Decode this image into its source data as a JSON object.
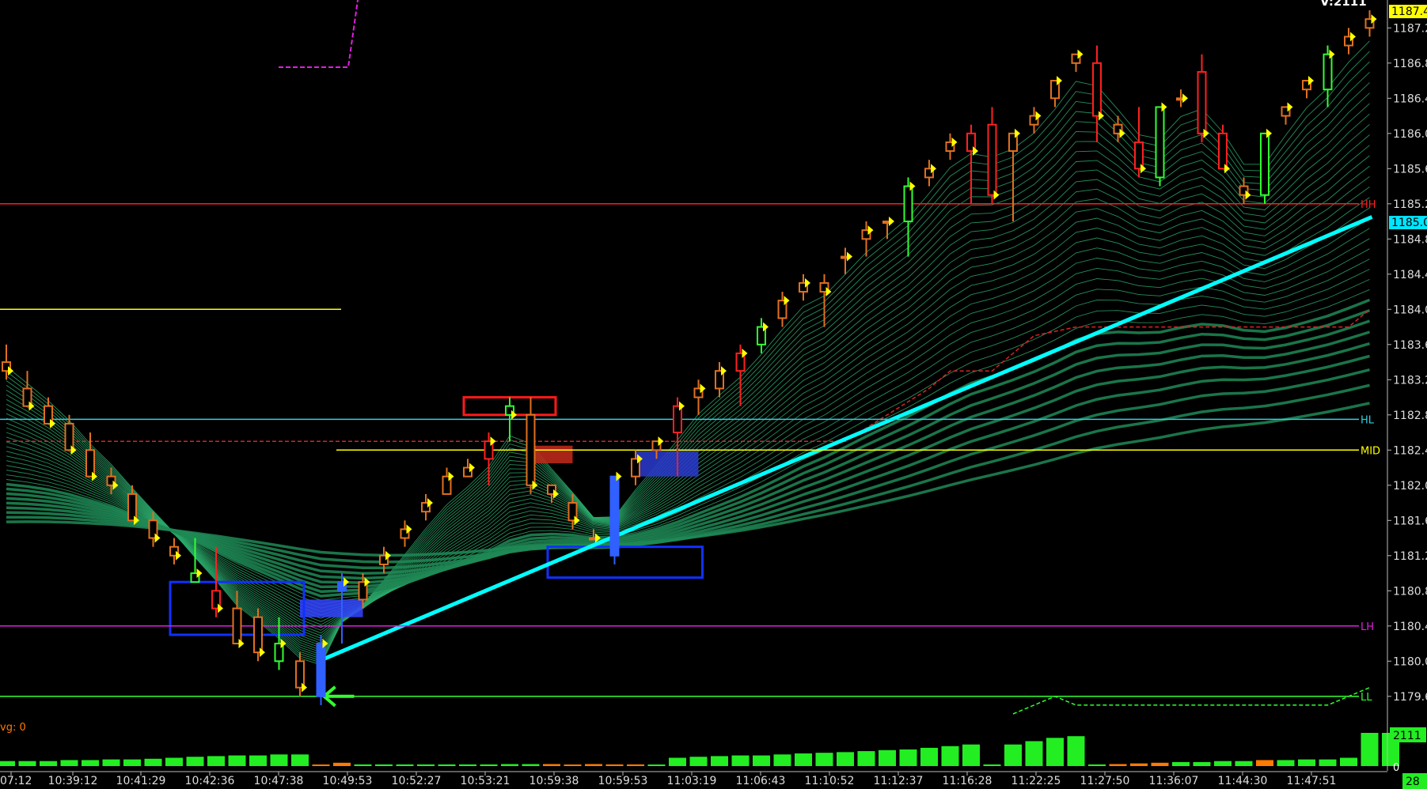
{
  "chart_data": {
    "type": "candlestick",
    "title": "",
    "corner_label": "V:2111",
    "avg_label": "vg: 0",
    "ylim": [
      1179.2,
      1187.6
    ],
    "y_ticks": [
      "1187.2",
      "1186.8",
      "1186.4",
      "1186.0",
      "1185.6",
      "1185.2",
      "1184.8",
      "1184.4",
      "1184.0",
      "1183.6",
      "1183.2",
      "1182.8",
      "1182.4",
      "1182.0",
      "1181.6",
      "1181.2",
      "1180.8",
      "1180.4",
      "1180.0",
      "1179.6"
    ],
    "x_ticks": [
      "07:12",
      "10:39:12",
      "10:41:29",
      "10:42:36",
      "10:47:38",
      "10:49:53",
      "10:52:27",
      "10:53:21",
      "10:59:38",
      "10:59:53",
      "11:03:19",
      "11:06:43",
      "11:10:52",
      "11:12:37",
      "11:16:28",
      "11:22:25",
      "11:27:50",
      "11:36:07",
      "11:44:30",
      "11:47:51"
    ],
    "current_price_label": "1187.4",
    "trendline_price_label": "1185.0",
    "volume_label": "2111",
    "volume_zero_label": "0",
    "volume_right_label": "28",
    "levels": [
      {
        "name": "HH",
        "price": 1185.2,
        "color": "#ff2020"
      },
      {
        "name": "HL",
        "price": 1182.75,
        "color": "#30d0e0"
      },
      {
        "name": "MID",
        "price": 1182.4,
        "color": "#ffff00"
      },
      {
        "name": "LH",
        "price": 1180.4,
        "color": "#e020e0"
      },
      {
        "name": "LL",
        "price": 1179.6,
        "color": "#30ff30"
      }
    ],
    "candles": [
      {
        "o": 1183.4,
        "h": 1183.6,
        "l": 1183.2,
        "c": 1183.3,
        "color": "#e07020"
      },
      {
        "o": 1183.1,
        "h": 1183.3,
        "l": 1182.9,
        "c": 1182.9,
        "color": "#e07020"
      },
      {
        "o": 1182.9,
        "h": 1183.0,
        "l": 1182.7,
        "c": 1182.7,
        "color": "#e07020"
      },
      {
        "o": 1182.7,
        "h": 1182.8,
        "l": 1182.4,
        "c": 1182.4,
        "color": "#e07020"
      },
      {
        "o": 1182.4,
        "h": 1182.6,
        "l": 1182.1,
        "c": 1182.1,
        "color": "#e07020"
      },
      {
        "o": 1182.1,
        "h": 1182.2,
        "l": 1181.9,
        "c": 1182.0,
        "color": "#e07020"
      },
      {
        "o": 1181.9,
        "h": 1182.0,
        "l": 1181.6,
        "c": 1181.6,
        "color": "#e07020"
      },
      {
        "o": 1181.6,
        "h": 1181.7,
        "l": 1181.3,
        "c": 1181.4,
        "color": "#e07020"
      },
      {
        "o": 1181.3,
        "h": 1181.4,
        "l": 1181.1,
        "c": 1181.2,
        "color": "#e07020"
      },
      {
        "o": 1180.9,
        "h": 1181.4,
        "l": 1180.9,
        "c": 1181.0,
        "color": "#30ff30"
      },
      {
        "o": 1180.8,
        "h": 1181.3,
        "l": 1180.5,
        "c": 1180.6,
        "color": "#ff2020"
      },
      {
        "o": 1180.6,
        "h": 1180.8,
        "l": 1180.2,
        "c": 1180.2,
        "color": "#e07020"
      },
      {
        "o": 1180.5,
        "h": 1180.6,
        "l": 1180.0,
        "c": 1180.1,
        "color": "#e07020"
      },
      {
        "o": 1180.0,
        "h": 1180.5,
        "l": 1179.9,
        "c": 1180.2,
        "color": "#30ff30"
      },
      {
        "o": 1180.0,
        "h": 1180.1,
        "l": 1179.6,
        "c": 1179.7,
        "color": "#e07020"
      },
      {
        "o": 1179.6,
        "h": 1180.3,
        "l": 1179.5,
        "c": 1180.2,
        "color": "#3060ff"
      },
      {
        "o": 1180.8,
        "h": 1181.0,
        "l": 1180.2,
        "c": 1180.9,
        "color": "#3060ff"
      },
      {
        "o": 1180.7,
        "h": 1181.0,
        "l": 1180.6,
        "c": 1180.9,
        "color": "#e07020"
      },
      {
        "o": 1181.1,
        "h": 1181.3,
        "l": 1181.0,
        "c": 1181.2,
        "color": "#e07020"
      },
      {
        "o": 1181.4,
        "h": 1181.6,
        "l": 1181.3,
        "c": 1181.5,
        "color": "#e07020"
      },
      {
        "o": 1181.7,
        "h": 1181.9,
        "l": 1181.6,
        "c": 1181.8,
        "color": "#e07020"
      },
      {
        "o": 1181.9,
        "h": 1182.2,
        "l": 1181.9,
        "c": 1182.1,
        "color": "#e07020"
      },
      {
        "o": 1182.1,
        "h": 1182.3,
        "l": 1182.1,
        "c": 1182.2,
        "color": "#e07020"
      },
      {
        "o": 1182.3,
        "h": 1182.6,
        "l": 1182.0,
        "c": 1182.5,
        "color": "#ff2020"
      },
      {
        "o": 1182.9,
        "h": 1183.0,
        "l": 1182.5,
        "c": 1182.8,
        "color": "#30ff30"
      },
      {
        "o": 1182.8,
        "h": 1183.0,
        "l": 1181.9,
        "c": 1182.0,
        "color": "#e07020"
      },
      {
        "o": 1182.0,
        "h": 1182.0,
        "l": 1181.8,
        "c": 1181.9,
        "color": "#e07020"
      },
      {
        "o": 1181.8,
        "h": 1181.9,
        "l": 1181.5,
        "c": 1181.6,
        "color": "#e07020"
      },
      {
        "o": 1181.4,
        "h": 1181.5,
        "l": 1181.4,
        "c": 1181.4,
        "color": "#e07020"
      },
      {
        "o": 1181.2,
        "h": 1182.1,
        "l": 1181.1,
        "c": 1182.1,
        "color": "#3060ff"
      },
      {
        "o": 1182.1,
        "h": 1182.4,
        "l": 1182.0,
        "c": 1182.3,
        "color": "#e07020"
      },
      {
        "o": 1182.4,
        "h": 1182.5,
        "l": 1182.3,
        "c": 1182.5,
        "color": "#e07020"
      },
      {
        "o": 1182.6,
        "h": 1183.0,
        "l": 1182.1,
        "c": 1182.9,
        "color": "#ff2020"
      },
      {
        "o": 1183.0,
        "h": 1183.2,
        "l": 1182.8,
        "c": 1183.1,
        "color": "#e07020"
      },
      {
        "o": 1183.1,
        "h": 1183.4,
        "l": 1183.0,
        "c": 1183.3,
        "color": "#e07020"
      },
      {
        "o": 1183.3,
        "h": 1183.6,
        "l": 1182.9,
        "c": 1183.5,
        "color": "#ff2020"
      },
      {
        "o": 1183.6,
        "h": 1183.9,
        "l": 1183.5,
        "c": 1183.8,
        "color": "#30ff30"
      },
      {
        "o": 1183.9,
        "h": 1184.2,
        "l": 1183.8,
        "c": 1184.1,
        "color": "#e07020"
      },
      {
        "o": 1184.2,
        "h": 1184.4,
        "l": 1184.1,
        "c": 1184.3,
        "color": "#e07020"
      },
      {
        "o": 1184.3,
        "h": 1184.4,
        "l": 1183.8,
        "c": 1184.2,
        "color": "#e07020"
      },
      {
        "o": 1184.6,
        "h": 1184.7,
        "l": 1184.4,
        "c": 1184.6,
        "color": "#e07020"
      },
      {
        "o": 1184.8,
        "h": 1185.0,
        "l": 1184.6,
        "c": 1184.9,
        "color": "#e07020"
      },
      {
        "o": 1185.0,
        "h": 1185.0,
        "l": 1184.8,
        "c": 1185.0,
        "color": "#e07020"
      },
      {
        "o": 1185.0,
        "h": 1185.5,
        "l": 1184.6,
        "c": 1185.4,
        "color": "#30ff30"
      },
      {
        "o": 1185.5,
        "h": 1185.7,
        "l": 1185.4,
        "c": 1185.6,
        "color": "#e07020"
      },
      {
        "o": 1185.8,
        "h": 1186.0,
        "l": 1185.7,
        "c": 1185.9,
        "color": "#e07020"
      },
      {
        "o": 1186.0,
        "h": 1186.1,
        "l": 1185.2,
        "c": 1185.8,
        "color": "#ff2020"
      },
      {
        "o": 1186.1,
        "h": 1186.3,
        "l": 1185.2,
        "c": 1185.3,
        "color": "#ff2020"
      },
      {
        "o": 1185.8,
        "h": 1186.0,
        "l": 1185.0,
        "c": 1186.0,
        "color": "#e07020"
      },
      {
        "o": 1186.1,
        "h": 1186.3,
        "l": 1186.0,
        "c": 1186.2,
        "color": "#e07020"
      },
      {
        "o": 1186.4,
        "h": 1186.6,
        "l": 1186.3,
        "c": 1186.6,
        "color": "#e07020"
      },
      {
        "o": 1186.8,
        "h": 1186.9,
        "l": 1186.7,
        "c": 1186.9,
        "color": "#e07020"
      },
      {
        "o": 1186.8,
        "h": 1187.0,
        "l": 1185.9,
        "c": 1186.2,
        "color": "#ff2020"
      },
      {
        "o": 1186.1,
        "h": 1186.2,
        "l": 1185.9,
        "c": 1186.0,
        "color": "#e07020"
      },
      {
        "o": 1185.9,
        "h": 1186.3,
        "l": 1185.5,
        "c": 1185.6,
        "color": "#ff2020"
      },
      {
        "o": 1185.5,
        "h": 1186.3,
        "l": 1185.4,
        "c": 1186.3,
        "color": "#30ff30"
      },
      {
        "o": 1186.4,
        "h": 1186.5,
        "l": 1186.3,
        "c": 1186.4,
        "color": "#e07020"
      },
      {
        "o": 1186.7,
        "h": 1186.9,
        "l": 1185.9,
        "c": 1186.0,
        "color": "#ff2020"
      },
      {
        "o": 1186.0,
        "h": 1186.1,
        "l": 1185.6,
        "c": 1185.6,
        "color": "#ff2020"
      },
      {
        "o": 1185.4,
        "h": 1185.5,
        "l": 1185.2,
        "c": 1185.3,
        "color": "#e07020"
      },
      {
        "o": 1185.3,
        "h": 1186.0,
        "l": 1185.2,
        "c": 1186.0,
        "color": "#30ff30"
      },
      {
        "o": 1186.2,
        "h": 1186.3,
        "l": 1186.1,
        "c": 1186.3,
        "color": "#e07020"
      },
      {
        "o": 1186.5,
        "h": 1186.6,
        "l": 1186.4,
        "c": 1186.6,
        "color": "#e07020"
      },
      {
        "o": 1186.5,
        "h": 1187.0,
        "l": 1186.3,
        "c": 1186.9,
        "color": "#30ff30"
      },
      {
        "o": 1187.0,
        "h": 1187.2,
        "l": 1186.9,
        "c": 1187.1,
        "color": "#e07020"
      },
      {
        "o": 1187.2,
        "h": 1187.4,
        "l": 1187.1,
        "c": 1187.3,
        "color": "#e07020"
      }
    ],
    "volume": [
      {
        "v": 0.15,
        "color": "#22ee22"
      },
      {
        "v": 0.15,
        "color": "#22ee22"
      },
      {
        "v": 0.15,
        "color": "#22ee22"
      },
      {
        "v": 0.18,
        "color": "#22ee22"
      },
      {
        "v": 0.18,
        "color": "#22ee22"
      },
      {
        "v": 0.2,
        "color": "#22ee22"
      },
      {
        "v": 0.2,
        "color": "#22ee22"
      },
      {
        "v": 0.22,
        "color": "#22ee22"
      },
      {
        "v": 0.25,
        "color": "#22ee22"
      },
      {
        "v": 0.28,
        "color": "#22ee22"
      },
      {
        "v": 0.3,
        "color": "#22ee22"
      },
      {
        "v": 0.32,
        "color": "#22ee22"
      },
      {
        "v": 0.32,
        "color": "#22ee22"
      },
      {
        "v": 0.35,
        "color": "#22ee22"
      },
      {
        "v": 0.35,
        "color": "#22ee22"
      },
      {
        "v": 0.03,
        "color": "#ff7a00"
      },
      {
        "v": 0.1,
        "color": "#ff7a00"
      },
      {
        "v": 0.05,
        "color": "#22ee22"
      },
      {
        "v": 0.05,
        "color": "#22ee22"
      },
      {
        "v": 0.05,
        "color": "#22ee22"
      },
      {
        "v": 0.05,
        "color": "#22ee22"
      },
      {
        "v": 0.05,
        "color": "#22ee22"
      },
      {
        "v": 0.05,
        "color": "#22ee22"
      },
      {
        "v": 0.05,
        "color": "#22ee22"
      },
      {
        "v": 0.06,
        "color": "#22ee22"
      },
      {
        "v": 0.06,
        "color": "#22ee22"
      },
      {
        "v": 0.06,
        "color": "#ff7a00"
      },
      {
        "v": 0.04,
        "color": "#ff7a00"
      },
      {
        "v": 0.06,
        "color": "#ff7a00"
      },
      {
        "v": 0.05,
        "color": "#ff7a00"
      },
      {
        "v": 0.05,
        "color": "#ff7a00"
      },
      {
        "v": 0.04,
        "color": "#22ee22"
      },
      {
        "v": 0.25,
        "color": "#22ee22"
      },
      {
        "v": 0.28,
        "color": "#22ee22"
      },
      {
        "v": 0.3,
        "color": "#22ee22"
      },
      {
        "v": 0.32,
        "color": "#22ee22"
      },
      {
        "v": 0.32,
        "color": "#22ee22"
      },
      {
        "v": 0.35,
        "color": "#22ee22"
      },
      {
        "v": 0.38,
        "color": "#22ee22"
      },
      {
        "v": 0.4,
        "color": "#22ee22"
      },
      {
        "v": 0.42,
        "color": "#22ee22"
      },
      {
        "v": 0.45,
        "color": "#22ee22"
      },
      {
        "v": 0.48,
        "color": "#22ee22"
      },
      {
        "v": 0.5,
        "color": "#22ee22"
      },
      {
        "v": 0.55,
        "color": "#22ee22"
      },
      {
        "v": 0.6,
        "color": "#22ee22"
      },
      {
        "v": 0.65,
        "color": "#22ee22"
      },
      {
        "v": 0.05,
        "color": "#22ee22"
      },
      {
        "v": 0.65,
        "color": "#22ee22"
      },
      {
        "v": 0.75,
        "color": "#22ee22"
      },
      {
        "v": 0.85,
        "color": "#22ee22"
      },
      {
        "v": 0.9,
        "color": "#22ee22"
      },
      {
        "v": 0.05,
        "color": "#22ee22"
      },
      {
        "v": 0.06,
        "color": "#ff7a00"
      },
      {
        "v": 0.08,
        "color": "#ff7a00"
      },
      {
        "v": 0.1,
        "color": "#ff7a00"
      },
      {
        "v": 0.12,
        "color": "#22ee22"
      },
      {
        "v": 0.12,
        "color": "#22ee22"
      },
      {
        "v": 0.15,
        "color": "#22ee22"
      },
      {
        "v": 0.15,
        "color": "#22ee22"
      },
      {
        "v": 0.18,
        "color": "#ff7a00"
      },
      {
        "v": 0.18,
        "color": "#22ee22"
      },
      {
        "v": 0.2,
        "color": "#22ee22"
      },
      {
        "v": 0.2,
        "color": "#22ee22"
      },
      {
        "v": 0.25,
        "color": "#22ee22"
      },
      {
        "v": 1.0,
        "color": "#22ee22"
      },
      {
        "v": 1.0,
        "color": "#22ee22"
      }
    ],
    "trendline": {
      "from": [
        15,
        1180.0
      ],
      "to": [
        65,
        1185.05
      ],
      "color": "#00ffff"
    },
    "zones": [
      {
        "name": "box",
        "i0": 8,
        "i1": 14,
        "p0": 1180.9,
        "p1": 1180.3,
        "color": "#1030ff"
      },
      {
        "name": "box",
        "i0": 22,
        "i1": 26,
        "p0": 1183.0,
        "p1": 1182.8,
        "color": "#ff1a1a"
      },
      {
        "name": "box",
        "i0": 26,
        "i1": 33,
        "p0": 1181.3,
        "p1": 1180.95,
        "color": "#1030ff"
      }
    ],
    "fills": [
      {
        "i0": 14,
        "i1": 17,
        "p0": 1180.7,
        "p1": 1180.5,
        "color": "#3344ff"
      },
      {
        "i0": 25,
        "i1": 27,
        "p0": 1182.45,
        "p1": 1182.25,
        "color": "#c42a1a"
      },
      {
        "i0": 30,
        "i1": 33,
        "p0": 1182.4,
        "p1": 1182.1,
        "color": "#2a3ad0"
      }
    ],
    "dashed_red": [
      [
        0,
        1182.5
      ],
      [
        40,
        1182.5
      ],
      [
        42,
        1182.8
      ],
      [
        44,
        1183.1
      ],
      [
        45,
        1183.3
      ],
      [
        47,
        1183.3
      ],
      [
        49,
        1183.7
      ],
      [
        51,
        1183.8
      ],
      [
        64,
        1183.8
      ],
      [
        65,
        1184.0
      ]
    ],
    "dashed_green": [
      [
        48,
        1179.4
      ],
      [
        50,
        1179.6
      ],
      [
        51,
        1179.5
      ],
      [
        63,
        1179.5
      ],
      [
        65,
        1179.7
      ]
    ],
    "upper_yellow": {
      "i0": 0,
      "i1": 16,
      "price": 1184.0
    }
  }
}
